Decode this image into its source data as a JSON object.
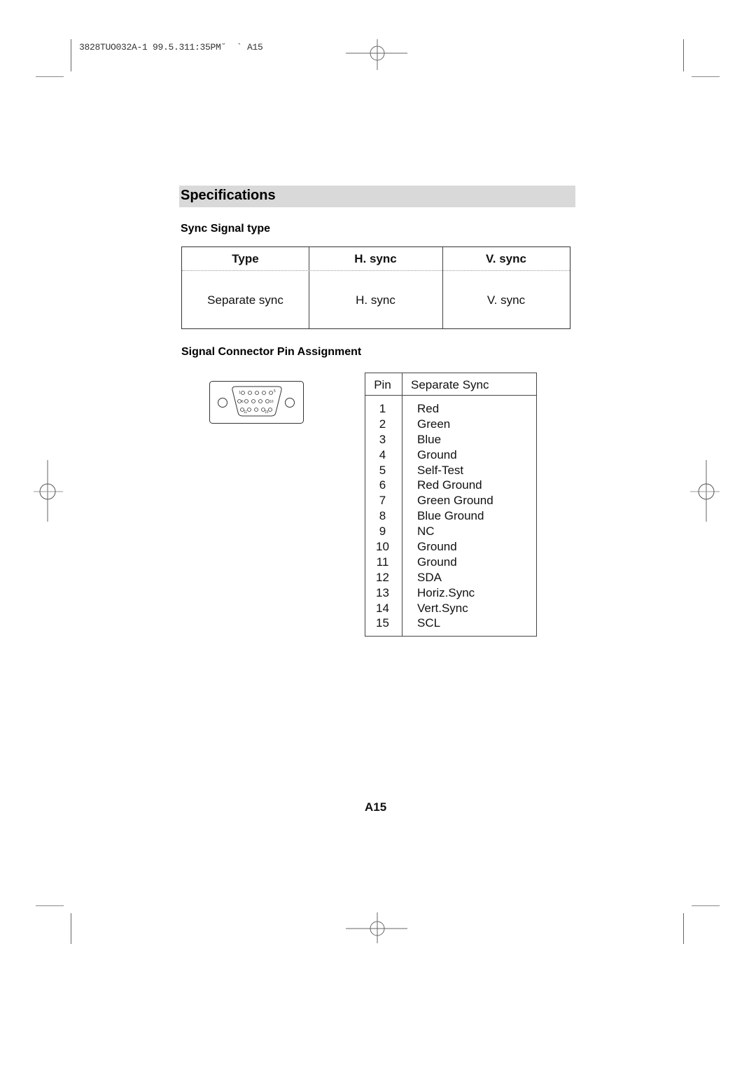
{
  "print_header": {
    "job_text": "3828TUO032A-1 99.5.311:35PM˘  ` A15"
  },
  "section": {
    "title": "Specifications"
  },
  "sync_signal": {
    "heading": "Sync Signal type",
    "columns": [
      "Type",
      "H. sync",
      "V. sync"
    ],
    "rows": [
      [
        "Separate sync",
        "H. sync",
        "V. sync"
      ]
    ]
  },
  "pin_assignment": {
    "heading": "Signal Connector Pin Assignment",
    "connector_icon": "d-sub-15-pin-connector-icon",
    "connector_labels": [
      "1",
      "5",
      "6",
      "10",
      "11",
      "15"
    ],
    "columns": [
      "Pin",
      "Separate Sync"
    ],
    "rows": [
      {
        "pin": "1",
        "signal": "Red"
      },
      {
        "pin": "2",
        "signal": "Green"
      },
      {
        "pin": "3",
        "signal": "Blue"
      },
      {
        "pin": "4",
        "signal": "Ground"
      },
      {
        "pin": "5",
        "signal": "Self-Test"
      },
      {
        "pin": "6",
        "signal": "Red Ground"
      },
      {
        "pin": "7",
        "signal": "Green Ground"
      },
      {
        "pin": "8",
        "signal": "Blue Ground"
      },
      {
        "pin": "9",
        "signal": "NC"
      },
      {
        "pin": "10",
        "signal": "Ground"
      },
      {
        "pin": "11",
        "signal": "Ground"
      },
      {
        "pin": "12",
        "signal": "SDA"
      },
      {
        "pin": "13",
        "signal": "Horiz.Sync"
      },
      {
        "pin": "14",
        "signal": "Vert.Sync"
      },
      {
        "pin": "15",
        "signal": "SCL"
      }
    ]
  },
  "footer": {
    "page_number": "A15"
  },
  "colors": {
    "title_bar": "#d9d9d9",
    "text": "#111111",
    "rule": "#444444"
  }
}
